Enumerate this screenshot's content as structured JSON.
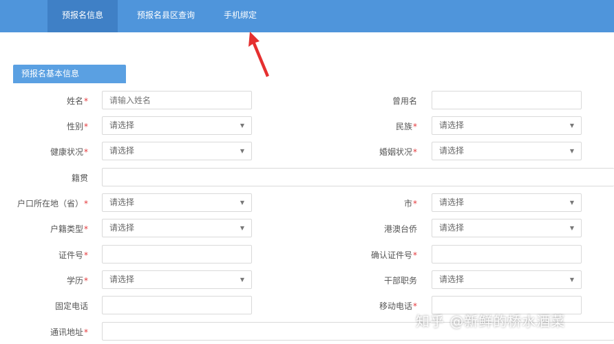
{
  "nav": {
    "tabs": [
      {
        "label": "预报名信息",
        "active": true
      },
      {
        "label": "预报名县区查询",
        "active": false
      },
      {
        "label": "手机绑定",
        "active": false
      }
    ]
  },
  "section": {
    "title": "预报名基本信息"
  },
  "form": {
    "name_label": "姓名",
    "name_placeholder": "请输入姓名",
    "former_name_label": "曾用名",
    "gender_label": "性别",
    "gender_value": "请选择",
    "ethnicity_label": "民族",
    "ethnicity_value": "请选择",
    "health_label": "健康状况",
    "health_value": "请选择",
    "marital_label": "婚姻状况",
    "marital_value": "请选择",
    "native_place_label": "籍贯",
    "hukou_province_label": "户口所在地（省）",
    "hukou_province_value": "请选择",
    "city_label": "市",
    "city_value": "请选择",
    "hukou_type_label": "户籍类型",
    "hukou_type_value": "请选择",
    "hmt_label": "港澳台侨",
    "hmt_value": "请选择",
    "id_label": "证件号",
    "id_confirm_label": "确认证件号",
    "education_label": "学历",
    "education_value": "请选择",
    "cadre_label": "干部职务",
    "cadre_value": "请选择",
    "phone_label": "固定电话",
    "mobile_label": "移动电话",
    "address_label": "通讯地址",
    "required_mark": "*",
    "caret": "▼"
  },
  "watermark": {
    "text": "知乎 @新鲜的桥水酒菜"
  },
  "colors": {
    "topbar": "#4f95db",
    "active_tab": "#3f80c6",
    "section_head": "#5aa0e2",
    "required": "#e4393c",
    "arrow": "#e53030"
  }
}
